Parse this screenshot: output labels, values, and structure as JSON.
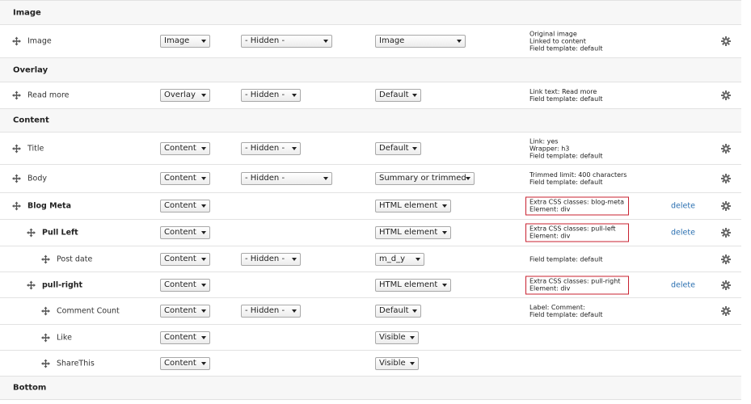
{
  "regions": {
    "image": "Image",
    "overlay": "Overlay",
    "content": "Content",
    "bottom": "Bottom"
  },
  "fields": {
    "image": {
      "label": "Image",
      "region": "Image",
      "parent": "- Hidden -",
      "formatter": "Image",
      "summary": [
        "Original image",
        "Linked to content",
        "Field template: default"
      ]
    },
    "read_more": {
      "label": "Read more",
      "region": "Overlay",
      "parent": "- Hidden -",
      "formatter": "Default",
      "summary": [
        "Link text: Read more",
        "Field template: default"
      ]
    },
    "title": {
      "label": "Title",
      "region": "Content",
      "parent": "- Hidden -",
      "formatter": "Default",
      "summary": [
        "Link: yes",
        "Wrapper: h3",
        "Field template: default"
      ]
    },
    "body": {
      "label": "Body",
      "region": "Content",
      "parent": "- Hidden -",
      "formatter": "Summary or trimmed",
      "summary": [
        "Trimmed limit: 400 characters",
        "Field template: default"
      ]
    },
    "blog_meta": {
      "label": "Blog Meta",
      "region": "Content",
      "formatter": "HTML element",
      "summary": [
        "Extra CSS classes: blog-meta",
        "Element: div"
      ],
      "delete": "delete"
    },
    "pull_left": {
      "label": "Pull Left",
      "region": "Content",
      "formatter": "HTML element",
      "summary": [
        "Extra CSS classes: pull-left",
        "Element: div"
      ],
      "delete": "delete"
    },
    "post_date": {
      "label": "Post date",
      "region": "Content",
      "parent": "- Hidden -",
      "formatter": "m_d_y",
      "summary": [
        "Field template: default"
      ]
    },
    "pull_right": {
      "label": "pull-right",
      "region": "Content",
      "formatter": "HTML element",
      "summary": [
        "Extra CSS classes: pull-right",
        "Element: div"
      ],
      "delete": "delete"
    },
    "comment_count": {
      "label": "Comment Count",
      "region": "Content",
      "parent": "- Hidden -",
      "formatter": "Default",
      "summary": [
        "Label: Comment:",
        "Field template: default"
      ]
    },
    "like": {
      "label": "Like",
      "region": "Content",
      "formatter": "Visible"
    },
    "sharethis": {
      "label": "ShareThis",
      "region": "Content",
      "formatter": "Visible"
    }
  },
  "colors": {
    "link": "#2a6fb0",
    "highlight_border": "#c8202f"
  }
}
